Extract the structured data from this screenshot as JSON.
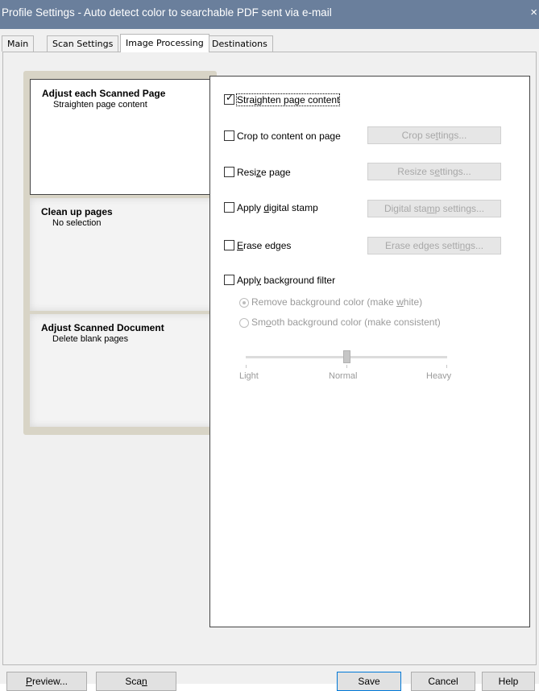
{
  "window": {
    "title": "Profile Settings - Auto detect color to searchable PDF sent via e-mail",
    "close_glyph": "×"
  },
  "tabs": [
    {
      "label": "Main"
    },
    {
      "label": "Scan Settings"
    },
    {
      "label": "Image Processing",
      "active": true
    },
    {
      "label": "Destinations"
    }
  ],
  "categories": [
    {
      "title": "Adjust each Scanned Page",
      "subtitle": "Straighten page content",
      "selected": true
    },
    {
      "title": "Clean up pages",
      "subtitle": "No selection"
    },
    {
      "title": "Adjust Scanned Document",
      "subtitle": "Delete blank pages"
    }
  ],
  "options": {
    "straighten": {
      "pre": "Stra",
      "key": "i",
      "post": "ghten page content",
      "checked": true,
      "check_glyph": "✓"
    },
    "crop": {
      "pre": "Crop to content on page",
      "key": "",
      "post": "",
      "checked": false,
      "button_pre": "Crop se",
      "button_key": "t",
      "button_post": "tings..."
    },
    "resize": {
      "pre": "Resi",
      "key": "z",
      "post": "e page",
      "checked": false,
      "button_pre": "Resize s",
      "button_key": "e",
      "button_post": "ttings..."
    },
    "stamp": {
      "pre": "Apply ",
      "key": "d",
      "post": "igital stamp",
      "checked": false,
      "button_pre": "Digital sta",
      "button_key": "m",
      "button_post": "p settings..."
    },
    "erase": {
      "pre": "",
      "key": "E",
      "post": "rase edges",
      "checked": false,
      "button_pre": "Erase edges setti",
      "button_key": "n",
      "button_post": "gs..."
    },
    "background": {
      "pre": "Appl",
      "key": "y",
      "post": " background filter",
      "checked": false
    }
  },
  "background_filter": {
    "remove": {
      "pre": "Remove background color (make ",
      "key": "w",
      "post": "hite)",
      "selected": true
    },
    "smooth": {
      "pre": "Sm",
      "key": "o",
      "post": "oth background color (make consistent)",
      "selected": false
    },
    "slider": {
      "labels": [
        "Light",
        "Normal",
        "Heavy"
      ],
      "value": 0.5
    }
  },
  "buttons": {
    "preview": {
      "pre": "",
      "key": "P",
      "post": "review..."
    },
    "scan": {
      "pre": "Sca",
      "key": "n",
      "post": ""
    },
    "save": "Save",
    "cancel": "Cancel",
    "help": "Help"
  }
}
